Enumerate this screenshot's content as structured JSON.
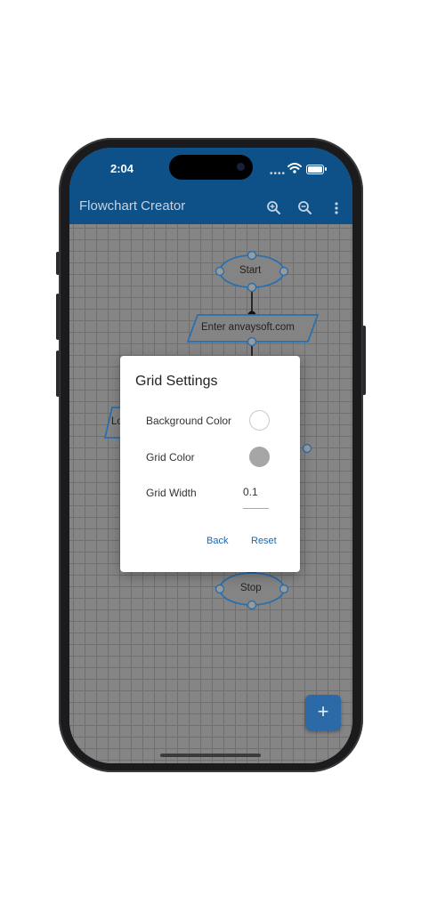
{
  "status_bar": {
    "time": "2:04"
  },
  "app_bar": {
    "title": "Flowchart Creator",
    "icons": [
      "zoom-in-icon",
      "zoom-out-icon",
      "more-vert-icon"
    ]
  },
  "flowchart": {
    "nodes": [
      {
        "shape": "ellipse",
        "label": "Start"
      },
      {
        "shape": "parallelogram",
        "label": "Enter anvaysoft.com"
      },
      {
        "shape": "parallelogram",
        "label": "Lo"
      },
      {
        "shape": "ellipse",
        "label": "Stop"
      }
    ]
  },
  "dialog": {
    "title": "Grid Settings",
    "background_color_label": "Background Color",
    "background_color_value": "#ffffff",
    "grid_color_label": "Grid Color",
    "grid_color_value": "#a6a6a6",
    "grid_width_label": "Grid Width",
    "grid_width_value": "0.1",
    "back_label": "Back",
    "reset_label": "Reset"
  },
  "fab": {
    "label": "+"
  },
  "colors": {
    "app_bar": "#0d5188",
    "accent": "#1f66ad",
    "node_stroke": "#2a6fae"
  }
}
